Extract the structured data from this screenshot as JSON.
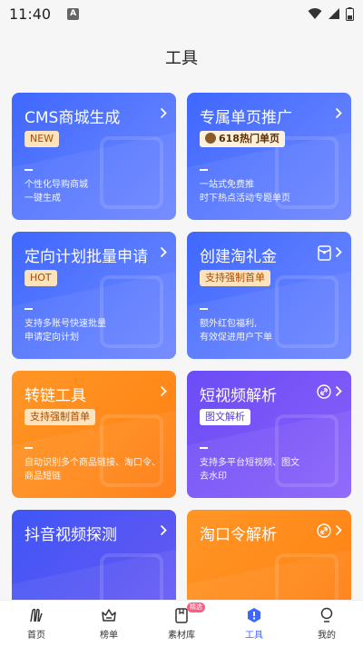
{
  "status_bar": {
    "time": "11:40",
    "a_badge": "A"
  },
  "header": {
    "title": "工具"
  },
  "cards": [
    {
      "title": "CMS商城生成",
      "badge": "NEW",
      "desc": [
        "个性化导购商城",
        "一键生成"
      ]
    },
    {
      "title": "专属单页推广",
      "badge": "618热门单页",
      "desc": [
        "一站式免费推",
        "时下热点活动专题单页"
      ]
    },
    {
      "title": "定向计划批量申请",
      "badge": "HOT",
      "desc": [
        "支持多账号快速批量",
        "申请定向计划"
      ]
    },
    {
      "title": "创建淘礼金",
      "badge": "支持强制首单",
      "desc": [
        "额外红包福利,",
        "有效促进用户下单"
      ]
    },
    {
      "title": "转链工具",
      "badge": "支持强制首单",
      "desc": [
        "自动识别多个商品链接、淘口令、",
        "商品短链"
      ]
    },
    {
      "title": "短视频解析",
      "badge": "图文解析",
      "desc": [
        "支持多平台短视频、图文",
        "去水印"
      ]
    },
    {
      "title": "抖音视频探测"
    },
    {
      "title": "淘口令解析"
    }
  ],
  "nav": {
    "home": "首页",
    "ranking": "榜单",
    "material": "素材库",
    "material_badge": "精选",
    "tools": "工具",
    "mine": "我的"
  },
  "colors": {
    "active": "#3f67ff",
    "blue_card": "#5b7bff",
    "purple_card": "#7e58f8",
    "orange_card": "#ff8a1a"
  },
  "icons": {
    "chevron": "chevron-right-icon",
    "link": "link-icon",
    "red_packet": "red-packet-icon"
  }
}
